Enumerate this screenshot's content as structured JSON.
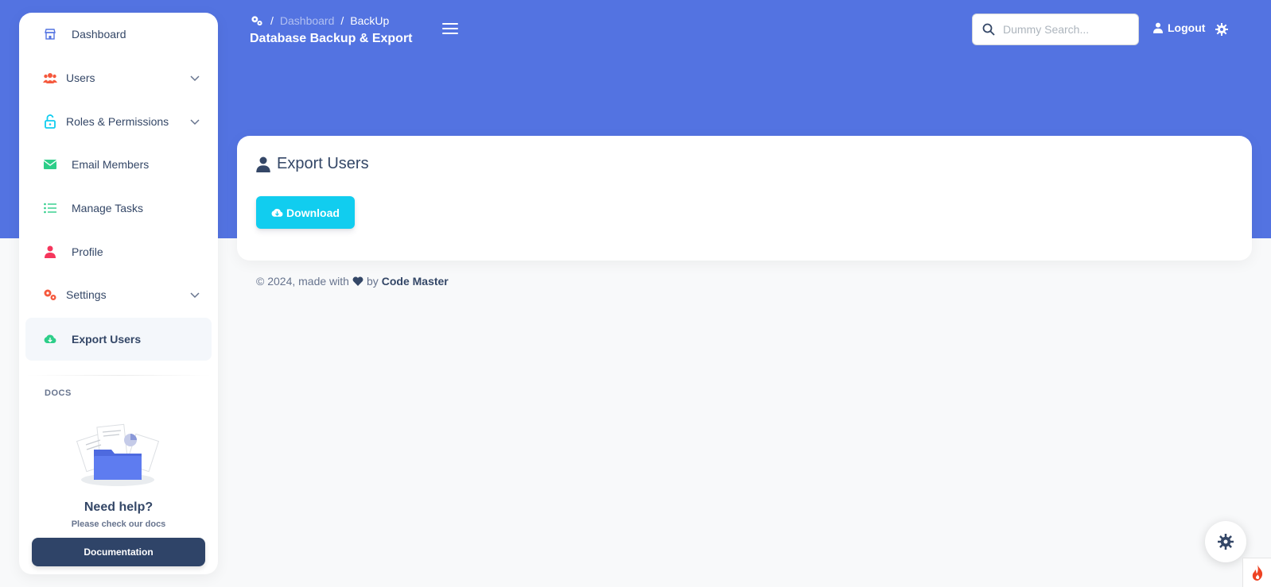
{
  "breadcrumb": {
    "items": [
      "Dashboard",
      "BackUp"
    ]
  },
  "header": {
    "title": "Database Backup & Export",
    "search_placeholder": "Dummy Search...",
    "logout_label": "Logout"
  },
  "sidebar": {
    "items": [
      {
        "label": "Dashboard",
        "icon": "shop-icon",
        "has_submenu": false
      },
      {
        "label": "Users",
        "icon": "users-icon",
        "has_submenu": true
      },
      {
        "label": "Roles & Permissions",
        "icon": "unlock-icon",
        "has_submenu": true
      },
      {
        "label": "Email Members",
        "icon": "envelope-icon",
        "has_submenu": false
      },
      {
        "label": "Manage Tasks",
        "icon": "list-icon",
        "has_submenu": false
      },
      {
        "label": "Profile",
        "icon": "user-icon",
        "has_submenu": false
      },
      {
        "label": "Settings",
        "icon": "cogs-icon",
        "has_submenu": true
      },
      {
        "label": "Export Users",
        "icon": "cloud-download-icon",
        "has_submenu": false,
        "active": true
      }
    ],
    "docs_heading": "DOCS",
    "help_title": "Need help?",
    "help_subtitle": "Please check our docs",
    "documentation_button": "Documentation"
  },
  "card": {
    "title": "Export Users",
    "download_label": "Download"
  },
  "footer": {
    "prefix": "© 2024, made with",
    "by": "by",
    "author": "Code Master"
  },
  "colors": {
    "header_bg": "#5373e1",
    "download_button": "#11cdef",
    "documentation_button": "#2f4468",
    "users_icon": "#f5593d",
    "roles_icon": "#11cdef",
    "email_icon": "#2dce89",
    "tasks_icon": "#2dce89",
    "profile_icon": "#f5365c",
    "settings_icon": "#f5593d",
    "export_icon": "#2dce89"
  }
}
